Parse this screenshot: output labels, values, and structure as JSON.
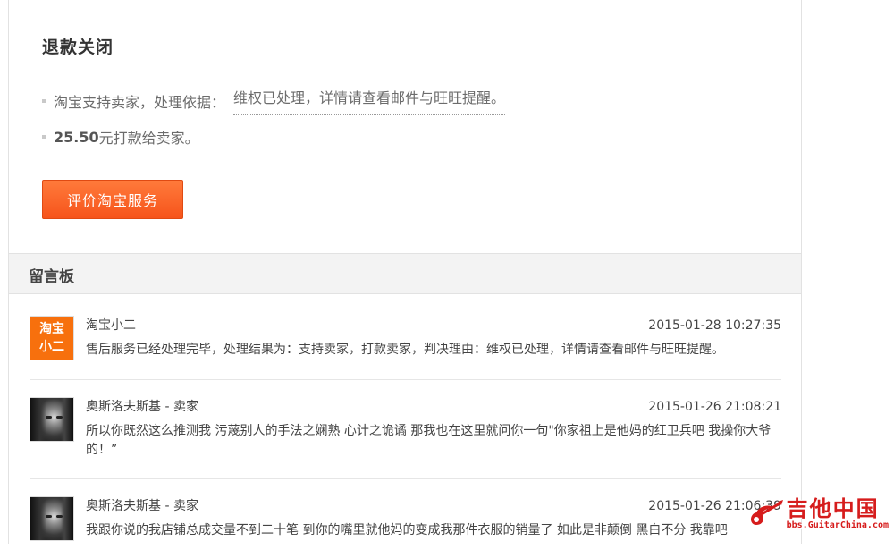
{
  "refund": {
    "status_title": "退款关闭",
    "basis_prefix": "淘宝支持卖家，处理依据：",
    "basis_link": "维权已处理，详情请查看邮件与旺旺提醒。",
    "amount": "25.50",
    "amount_suffix": "元打款给卖家。",
    "rate_button": "评价淘宝服务"
  },
  "board": {
    "title": "留言板",
    "messages": [
      {
        "avatar_text_1": "淘宝",
        "avatar_text_2": "小二",
        "author": "淘宝小二",
        "time": "2015-01-28 10:27:35",
        "text": "售后服务已经处理完毕，处理结果为：支持卖家，打款卖家，判决理由：维权已处理，详情请查看邮件与旺旺提醒。"
      },
      {
        "author": "奥斯洛夫斯基 - 卖家",
        "time": "2015-01-26 21:08:21",
        "text": "所以你既然这么推测我 污蔑别人的手法之娴熟 心计之诡谲 那我也在这里就问你一句\"你家祖上是他妈的红卫兵吧 我操你大爷的！”"
      },
      {
        "author": "奥斯洛夫斯基 - 卖家",
        "time": "2015-01-26 21:06:39",
        "text": "我跟你说的我店铺总成交量不到二十笔 到你的嘴里就他妈的变成我那件衣服的销量了 如此是非颠倒 黑白不分 我靠吧"
      }
    ]
  },
  "watermark": {
    "cn": "吉他中国",
    "en": "bbs.GuitarChina.com"
  },
  "colors": {
    "accent": "#f6541b",
    "xiaoer_avatar": "#f7700d",
    "watermark": "#d61c1c"
  }
}
